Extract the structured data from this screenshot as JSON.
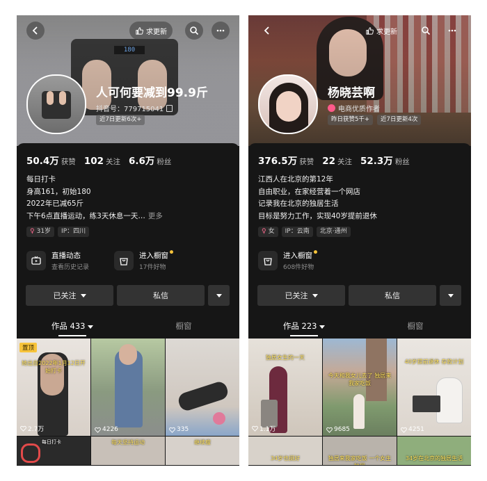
{
  "left": {
    "top_bar": {
      "request_update": "求更新"
    },
    "profile": {
      "name": "人可何要减到99.9斤",
      "account_line": "抖音号：779715041",
      "pills": [
        "近7日更新6次+"
      ],
      "scale_reading": "180"
    },
    "stats": {
      "likes_value": "50.4万",
      "likes_label": "获赞",
      "following_value": "102",
      "following_label": "关注",
      "fans_value": "6.6万",
      "fans_label": "粉丝"
    },
    "bio": [
      "每日打卡",
      "身高161，初始180",
      "2022年已减65斤",
      "下午6点直播运动，练3天休息一天…"
    ],
    "bio_more": "更多",
    "tags": [
      "31岁",
      "IP：四川"
    ],
    "entries": [
      {
        "title": "直播动态",
        "sub": "查看历史记录"
      },
      {
        "title": "进入橱窗",
        "sub": "17件好物"
      }
    ],
    "buttons": {
      "follow": "已关注",
      "message": "私信"
    },
    "tabs": {
      "works": "作品 433",
      "window": "橱窗"
    },
    "grid": [
      {
        "pinned": "置顶",
        "caption": "她出自2022年1月12日开始打卡",
        "likes": "2.7万"
      },
      {
        "likes": "4226"
      },
      {
        "likes": "335"
      },
      {
        "caption": "每日打卡"
      },
      {
        "caption": "每天坚持运动"
      },
      {
        "caption": "继续瘦"
      }
    ]
  },
  "right": {
    "top_bar": {
      "request_update": "求更新"
    },
    "profile": {
      "name": "杨晓芸啊",
      "badge": "电商优质作者",
      "pills": [
        "昨日获赞5千+",
        "近7日更新4次"
      ]
    },
    "stats": {
      "likes_value": "376.5万",
      "likes_label": "获赞",
      "following_value": "22",
      "following_label": "关注",
      "fans_value": "52.3万",
      "fans_label": "粉丝"
    },
    "bio": [
      "江西人在北京的第12年",
      "自由职业，在家经营着一个网店",
      "记录我在北京的独居生活",
      "目标是努力工作，实现40岁提前退休"
    ],
    "tags": [
      "女",
      "IP：云南",
      "北京·通州"
    ],
    "entries": [
      {
        "title": "进入橱窗",
        "sub": "608件好物"
      }
    ],
    "buttons": {
      "follow": "已关注",
      "message": "私信"
    },
    "tabs": {
      "works": "作品 223",
      "window": "橱窗"
    },
    "grid": [
      {
        "caption": "独居女生的一天",
        "likes": "1.1万"
      },
      {
        "caption": "今天和我女儿去了 独居来我家吃饭",
        "likes": "9685"
      },
      {
        "caption": "40岁提前退休 存款计划",
        "likes": "4251"
      },
      {
        "caption": "34岁也挺好"
      },
      {
        "caption": "独居来我家吃饭 一个女生独居"
      },
      {
        "caption": "34岁在北京的独居生活"
      }
    ]
  },
  "colors": {
    "accent_yellow": "#f7c33a",
    "panel_bg": "#161616",
    "button_bg": "#333333"
  }
}
